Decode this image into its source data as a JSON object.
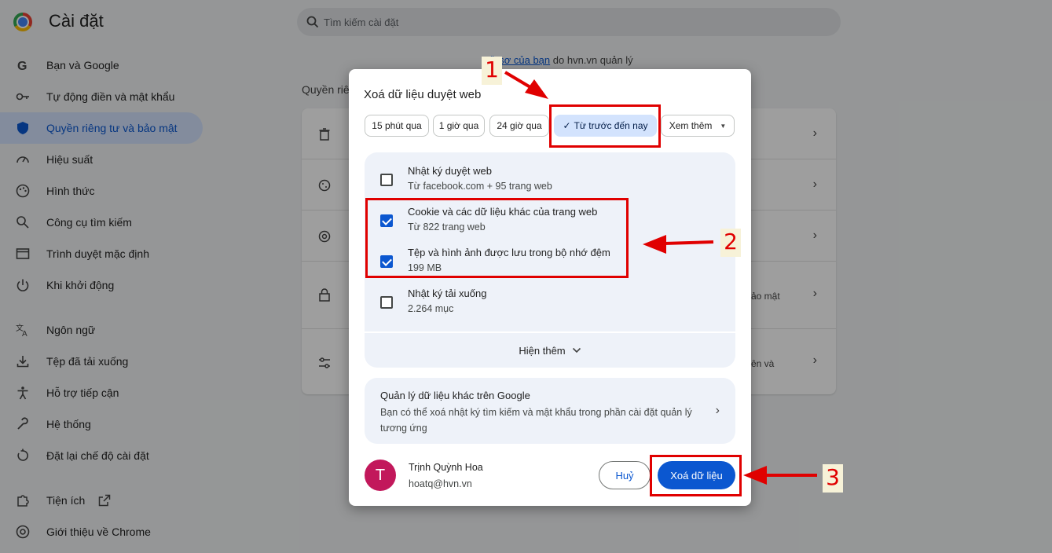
{
  "app": {
    "title": "Cài đặt"
  },
  "search": {
    "placeholder": "Tìm kiếm cài đặt"
  },
  "sidebar": {
    "items": [
      {
        "label": "Bạn và Google",
        "icon": "google-icon"
      },
      {
        "label": "Tự động điền và mật khẩu",
        "icon": "key-icon"
      },
      {
        "label": "Quyền riêng tư và bảo mật",
        "icon": "shield-icon",
        "active": true
      },
      {
        "label": "Hiệu suất",
        "icon": "speedometer-icon"
      },
      {
        "label": "Hình thức",
        "icon": "palette-icon"
      },
      {
        "label": "Công cụ tìm kiếm",
        "icon": "search-icon"
      },
      {
        "label": "Trình duyệt mặc định",
        "icon": "browser-icon"
      },
      {
        "label": "Khi khởi động",
        "icon": "power-icon"
      },
      {
        "label": "Ngôn ngữ",
        "icon": "translate-icon"
      },
      {
        "label": "Tệp đã tải xuống",
        "icon": "download-icon"
      },
      {
        "label": "Hỗ trợ tiếp cận",
        "icon": "accessibility-icon"
      },
      {
        "label": "Hệ thống",
        "icon": "wrench-icon"
      },
      {
        "label": "Đặt lại chế độ cài đặt",
        "icon": "reset-icon"
      },
      {
        "label": "Tiện ích",
        "icon": "puzzle-icon"
      },
      {
        "label": "Giới thiệu về Chrome",
        "icon": "chrome-icon"
      }
    ]
  },
  "content": {
    "profile_link": "Hồ sơ của bạn",
    "profile_suffix": "do hvn.vn quản lý",
    "section_label": "Quyền riê",
    "partial_text_1": "ảo mật",
    "partial_text_2": "ên và"
  },
  "dialog": {
    "title": "Xoá dữ liệu duyệt web",
    "time_ranges": [
      "15 phút qua",
      "1 giờ qua",
      "24 giờ qua",
      "Từ trước đến nay"
    ],
    "selected_range": "Từ trước đến nay",
    "more_range_label": "Xem thêm",
    "options": [
      {
        "title": "Nhật ký duyệt web",
        "subtitle": "Từ facebook.com + 95 trang web",
        "checked": false
      },
      {
        "title": "Cookie và các dữ liệu khác của trang web",
        "subtitle": "Từ 822 trang web",
        "checked": true
      },
      {
        "title": "Tệp và hình ảnh được lưu trong bộ nhớ đệm",
        "subtitle": "199 MB",
        "checked": true
      },
      {
        "title": "Nhật ký tải xuống",
        "subtitle": "2.264 mục",
        "checked": false
      }
    ],
    "show_more_label": "Hiện thêm",
    "google_panel": {
      "title": "Quản lý dữ liệu khác trên Google",
      "description": "Bạn có thể xoá nhật ký tìm kiếm và mật khẩu trong phần cài đặt quản lý tương ứng"
    },
    "account": {
      "initial": "T",
      "name": "Trịnh Quỳnh Hoa",
      "email": "hoatq@hvn.vn",
      "avatar_color": "#c2185b"
    },
    "cancel_label": "Huỷ",
    "clear_label": "Xoá dữ liệu"
  },
  "annotations": {
    "step1": "1",
    "step2": "2",
    "step3": "3",
    "color": "#e00000"
  },
  "colors": {
    "accent": "#0b57d0",
    "selected_chip": "#d3e3fd",
    "panel": "#eef2f9"
  }
}
